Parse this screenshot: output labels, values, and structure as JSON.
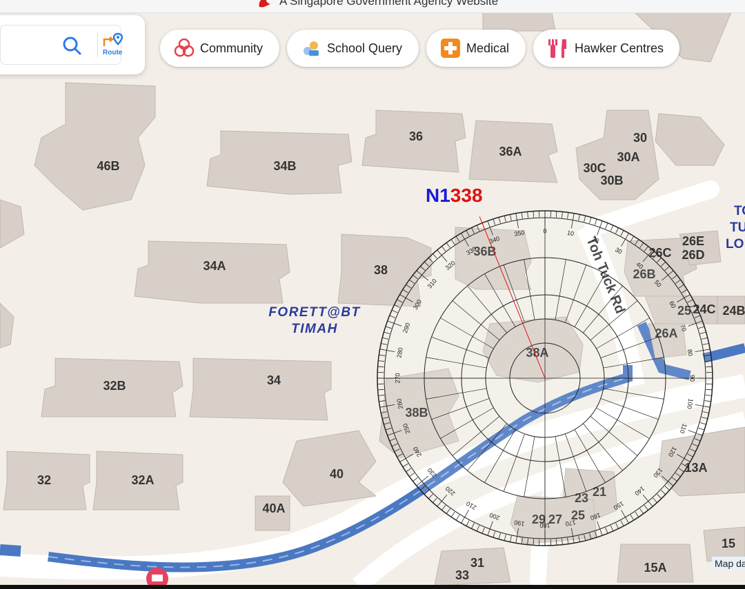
{
  "header": {
    "gov_text": "A Singapore Government Agency Website"
  },
  "search": {
    "route_label": "Route"
  },
  "categories": [
    {
      "label": "Community",
      "icon": "community-icon",
      "color": "#e5414d"
    },
    {
      "label": "School Query",
      "icon": "school-icon",
      "color": "#4a90d9"
    },
    {
      "label": "Medical",
      "icon": "medical-cross-icon",
      "color": "#f28a1e"
    },
    {
      "label": "Hawker Centres",
      "icon": "fork-knife-icon",
      "color": "#e83e6b"
    }
  ],
  "compass": {
    "north_label": "N1",
    "bearing": "338",
    "north_color": "#1a1adb",
    "bearing_color": "#e01010"
  },
  "buildings": [
    "46B",
    "34B",
    "36",
    "36A",
    "30",
    "30A",
    "30C",
    "30B",
    "34A",
    "38",
    "36B",
    "26C",
    "26E",
    "26D",
    "26B",
    "25",
    "24C",
    "24B",
    "26A",
    "38A",
    "32B",
    "34",
    "38B",
    "32",
    "32A",
    "40",
    "40A",
    "13A",
    "23",
    "21",
    "25",
    "29",
    "27",
    "15",
    "15A",
    "31",
    "33"
  ],
  "places": [
    "FORETT@BT",
    "TIMAH"
  ],
  "road_labels": [
    "Toh Tuck Rd",
    "TO",
    "TU",
    "LO"
  ],
  "map_attribution": "Map da",
  "colors": {
    "map_bg": "#f3efe8",
    "building": "#d8d0c8",
    "road": "#ffffff",
    "cycle": "#4a78c2"
  }
}
